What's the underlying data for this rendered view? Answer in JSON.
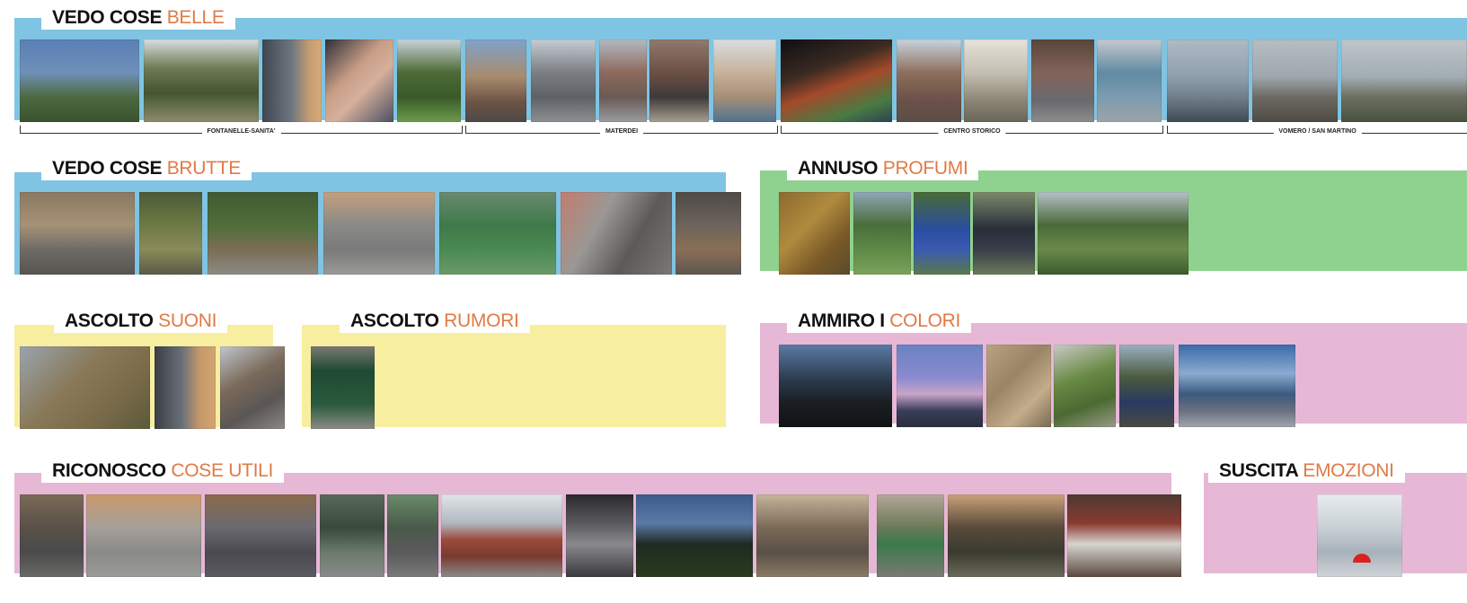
{
  "colors": {
    "blue_band": "#7fc4e3",
    "green_band": "#8fd18e",
    "yellow_band": "#f7ef9f",
    "pink_band": "#e7b7d6",
    "accent_text": "#e07a45",
    "title_text": "#111111"
  },
  "sections": {
    "vedo_belle": {
      "prefix": "VEDO COSE ",
      "accent": "BELLE"
    },
    "vedo_brutte": {
      "prefix": "VEDO COSE ",
      "accent": "BRUTTE"
    },
    "annuso_profumi": {
      "prefix": "ANNUSO ",
      "accent": "PROFUMI"
    },
    "ascolto_suoni": {
      "prefix": "ASCOLTO ",
      "accent": "SUONI"
    },
    "ascolto_rumori": {
      "prefix": "ASCOLTO ",
      "accent": "RUMORI"
    },
    "ammiro_colori": {
      "prefix": "AMMIRO I ",
      "accent": "COLORI"
    },
    "riconosco_utili": {
      "prefix": "RICONOSCO ",
      "accent": "COSE UTILI"
    },
    "suscita_emozioni": {
      "prefix": "SUSCITA ",
      "accent": "EMOZIONI"
    }
  },
  "areas": {
    "fontanelle": "FONTANELLE-SANITA'",
    "materdei": "MATERDEI",
    "centro_storico": "CENTRO STORICO",
    "vomero": "VOMERO / SAN MARTINO"
  }
}
